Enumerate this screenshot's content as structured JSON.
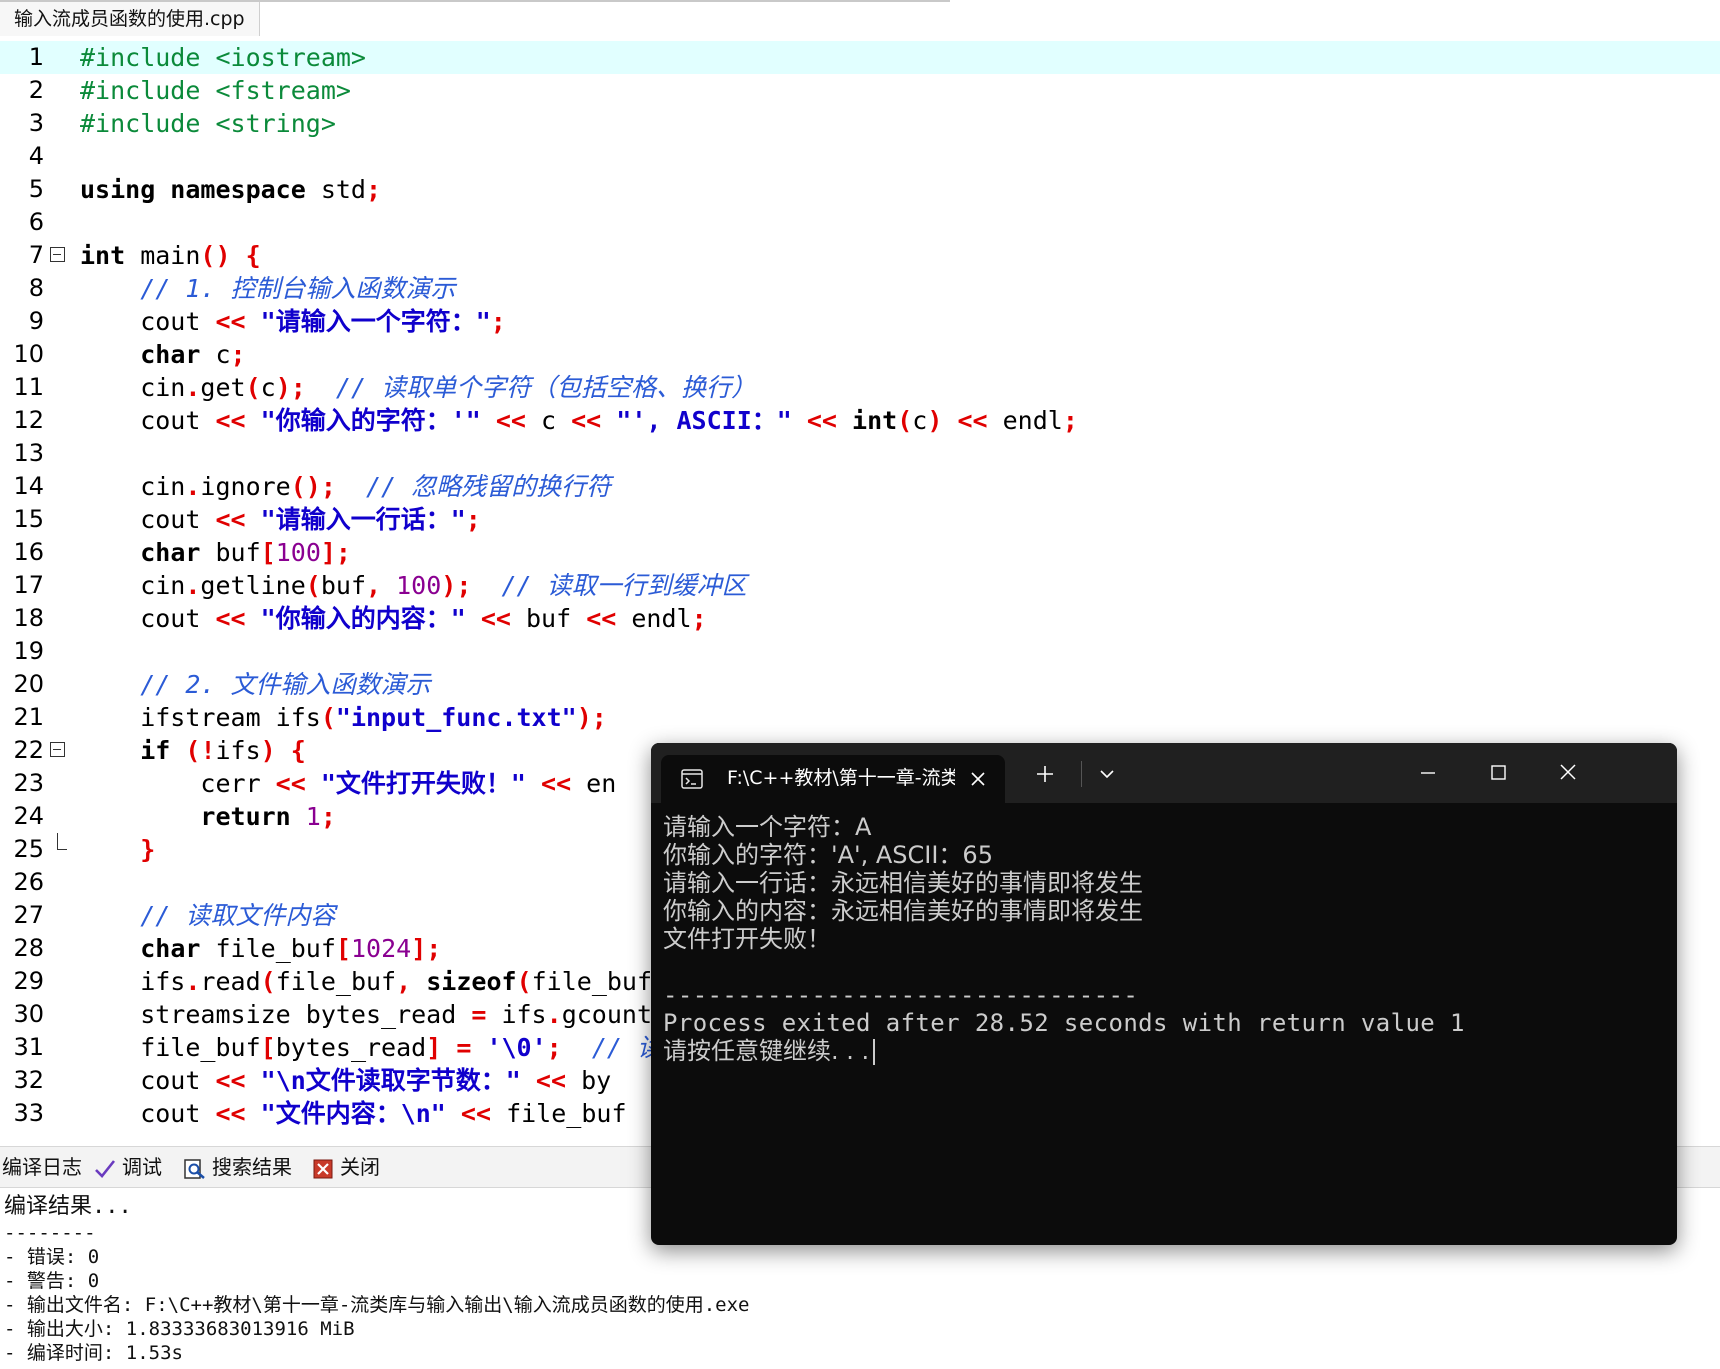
{
  "editor": {
    "file_tab": "输入流成员函数的使用.cpp",
    "lines": [
      {
        "n": "1",
        "tokens": [
          {
            "c": "pp",
            "t": "#include <iostream>"
          }
        ]
      },
      {
        "n": "2",
        "tokens": [
          {
            "c": "pp",
            "t": "#include <fstream>"
          }
        ]
      },
      {
        "n": "3",
        "tokens": [
          {
            "c": "pp",
            "t": "#include <string>"
          }
        ]
      },
      {
        "n": "4",
        "tokens": []
      },
      {
        "n": "5",
        "tokens": [
          {
            "c": "kw",
            "t": "using namespace"
          },
          {
            "c": "",
            "t": " std"
          },
          {
            "c": "sy",
            "t": ";"
          }
        ]
      },
      {
        "n": "6",
        "tokens": []
      },
      {
        "n": "7",
        "tokens": [
          {
            "c": "kw",
            "t": "int"
          },
          {
            "c": "",
            "t": " main"
          },
          {
            "c": "sy",
            "t": "() {"
          }
        ]
      },
      {
        "n": "8",
        "tokens": [
          {
            "c": "",
            "t": "    "
          },
          {
            "c": "cm",
            "t": "// 1. 控制台输入函数演示"
          }
        ]
      },
      {
        "n": "9",
        "tokens": [
          {
            "c": "",
            "t": "    cout "
          },
          {
            "c": "sy",
            "t": "<<"
          },
          {
            "c": "",
            "t": " "
          },
          {
            "c": "st",
            "t": "\"请输入一个字符：\""
          },
          {
            "c": "sy",
            "t": ";"
          }
        ]
      },
      {
        "n": "10",
        "tokens": [
          {
            "c": "",
            "t": "    "
          },
          {
            "c": "kw",
            "t": "char"
          },
          {
            "c": "",
            "t": " c"
          },
          {
            "c": "sy",
            "t": ";"
          }
        ]
      },
      {
        "n": "11",
        "tokens": [
          {
            "c": "",
            "t": "    cin"
          },
          {
            "c": "sy",
            "t": "."
          },
          {
            "c": "",
            "t": "get"
          },
          {
            "c": "sy",
            "t": "("
          },
          {
            "c": "",
            "t": "c"
          },
          {
            "c": "sy",
            "t": ");"
          },
          {
            "c": "",
            "t": "  "
          },
          {
            "c": "cm",
            "t": "// 读取单个字符（包括空格、换行）"
          }
        ]
      },
      {
        "n": "12",
        "tokens": [
          {
            "c": "",
            "t": "    cout "
          },
          {
            "c": "sy",
            "t": "<<"
          },
          {
            "c": "",
            "t": " "
          },
          {
            "c": "st",
            "t": "\"你输入的字符：'\""
          },
          {
            "c": "",
            "t": " "
          },
          {
            "c": "sy",
            "t": "<<"
          },
          {
            "c": "",
            "t": " c "
          },
          {
            "c": "sy",
            "t": "<<"
          },
          {
            "c": "",
            "t": " "
          },
          {
            "c": "st",
            "t": "\"', ASCII：\""
          },
          {
            "c": "",
            "t": " "
          },
          {
            "c": "sy",
            "t": "<<"
          },
          {
            "c": "",
            "t": " "
          },
          {
            "c": "kw",
            "t": "int"
          },
          {
            "c": "sy",
            "t": "("
          },
          {
            "c": "",
            "t": "c"
          },
          {
            "c": "sy",
            "t": ")"
          },
          {
            "c": "",
            "t": " "
          },
          {
            "c": "sy",
            "t": "<<"
          },
          {
            "c": "",
            "t": " endl"
          },
          {
            "c": "sy",
            "t": ";"
          }
        ]
      },
      {
        "n": "13",
        "tokens": []
      },
      {
        "n": "14",
        "tokens": [
          {
            "c": "",
            "t": "    cin"
          },
          {
            "c": "sy",
            "t": "."
          },
          {
            "c": "",
            "t": "ignore"
          },
          {
            "c": "sy",
            "t": "();"
          },
          {
            "c": "",
            "t": "  "
          },
          {
            "c": "cm",
            "t": "// 忽略残留的换行符"
          }
        ]
      },
      {
        "n": "15",
        "tokens": [
          {
            "c": "",
            "t": "    cout "
          },
          {
            "c": "sy",
            "t": "<<"
          },
          {
            "c": "",
            "t": " "
          },
          {
            "c": "st",
            "t": "\"请输入一行话：\""
          },
          {
            "c": "sy",
            "t": ";"
          }
        ]
      },
      {
        "n": "16",
        "tokens": [
          {
            "c": "",
            "t": "    "
          },
          {
            "c": "kw",
            "t": "char"
          },
          {
            "c": "",
            "t": " buf"
          },
          {
            "c": "sy",
            "t": "["
          },
          {
            "c": "nm",
            "t": "100"
          },
          {
            "c": "sy",
            "t": "];"
          }
        ]
      },
      {
        "n": "17",
        "tokens": [
          {
            "c": "",
            "t": "    cin"
          },
          {
            "c": "sy",
            "t": "."
          },
          {
            "c": "",
            "t": "getline"
          },
          {
            "c": "sy",
            "t": "("
          },
          {
            "c": "",
            "t": "buf"
          },
          {
            "c": "sy",
            "t": ","
          },
          {
            "c": "",
            "t": " "
          },
          {
            "c": "nm",
            "t": "100"
          },
          {
            "c": "sy",
            "t": ");"
          },
          {
            "c": "",
            "t": "  "
          },
          {
            "c": "cm",
            "t": "// 读取一行到缓冲区"
          }
        ]
      },
      {
        "n": "18",
        "tokens": [
          {
            "c": "",
            "t": "    cout "
          },
          {
            "c": "sy",
            "t": "<<"
          },
          {
            "c": "",
            "t": " "
          },
          {
            "c": "st",
            "t": "\"你输入的内容：\""
          },
          {
            "c": "",
            "t": " "
          },
          {
            "c": "sy",
            "t": "<<"
          },
          {
            "c": "",
            "t": " buf "
          },
          {
            "c": "sy",
            "t": "<<"
          },
          {
            "c": "",
            "t": " endl"
          },
          {
            "c": "sy",
            "t": ";"
          }
        ]
      },
      {
        "n": "19",
        "tokens": []
      },
      {
        "n": "20",
        "tokens": [
          {
            "c": "",
            "t": "    "
          },
          {
            "c": "cm",
            "t": "// 2. 文件输入函数演示"
          }
        ]
      },
      {
        "n": "21",
        "tokens": [
          {
            "c": "",
            "t": "    ifstream ifs"
          },
          {
            "c": "sy",
            "t": "("
          },
          {
            "c": "st",
            "t": "\"input_func.txt\""
          },
          {
            "c": "sy",
            "t": ");"
          }
        ]
      },
      {
        "n": "22",
        "tokens": [
          {
            "c": "",
            "t": "    "
          },
          {
            "c": "kw",
            "t": "if"
          },
          {
            "c": "",
            "t": " "
          },
          {
            "c": "sy",
            "t": "(!"
          },
          {
            "c": "",
            "t": "ifs"
          },
          {
            "c": "sy",
            "t": ") {"
          }
        ]
      },
      {
        "n": "23",
        "tokens": [
          {
            "c": "",
            "t": "        cerr "
          },
          {
            "c": "sy",
            "t": "<<"
          },
          {
            "c": "",
            "t": " "
          },
          {
            "c": "st",
            "t": "\"文件打开失败！\""
          },
          {
            "c": "",
            "t": " "
          },
          {
            "c": "sy",
            "t": "<<"
          },
          {
            "c": "",
            "t": " en"
          }
        ]
      },
      {
        "n": "24",
        "tokens": [
          {
            "c": "",
            "t": "        "
          },
          {
            "c": "kw",
            "t": "return"
          },
          {
            "c": "",
            "t": " "
          },
          {
            "c": "nm",
            "t": "1"
          },
          {
            "c": "sy",
            "t": ";"
          }
        ]
      },
      {
        "n": "25",
        "tokens": [
          {
            "c": "",
            "t": "    "
          },
          {
            "c": "sy",
            "t": "}"
          }
        ]
      },
      {
        "n": "26",
        "tokens": []
      },
      {
        "n": "27",
        "tokens": [
          {
            "c": "",
            "t": "    "
          },
          {
            "c": "cm",
            "t": "// 读取文件内容"
          }
        ]
      },
      {
        "n": "28",
        "tokens": [
          {
            "c": "",
            "t": "    "
          },
          {
            "c": "kw",
            "t": "char"
          },
          {
            "c": "",
            "t": " file_buf"
          },
          {
            "c": "sy",
            "t": "["
          },
          {
            "c": "nm",
            "t": "1024"
          },
          {
            "c": "sy",
            "t": "];"
          }
        ]
      },
      {
        "n": "29",
        "tokens": [
          {
            "c": "",
            "t": "    ifs"
          },
          {
            "c": "sy",
            "t": "."
          },
          {
            "c": "",
            "t": "read"
          },
          {
            "c": "sy",
            "t": "("
          },
          {
            "c": "",
            "t": "file_buf"
          },
          {
            "c": "sy",
            "t": ","
          },
          {
            "c": "",
            "t": " "
          },
          {
            "c": "kw",
            "t": "sizeof"
          },
          {
            "c": "sy",
            "t": "("
          },
          {
            "c": "",
            "t": "file_buf"
          }
        ]
      },
      {
        "n": "30",
        "tokens": [
          {
            "c": "",
            "t": "    streamsize bytes_read "
          },
          {
            "c": "sy",
            "t": "="
          },
          {
            "c": "",
            "t": " ifs"
          },
          {
            "c": "sy",
            "t": "."
          },
          {
            "c": "",
            "t": "gcount"
          }
        ]
      },
      {
        "n": "31",
        "tokens": [
          {
            "c": "",
            "t": "    file_buf"
          },
          {
            "c": "sy",
            "t": "["
          },
          {
            "c": "",
            "t": "bytes_read"
          },
          {
            "c": "sy",
            "t": "]"
          },
          {
            "c": "",
            "t": " "
          },
          {
            "c": "sy",
            "t": "="
          },
          {
            "c": "",
            "t": " "
          },
          {
            "c": "st",
            "t": "'\\0'"
          },
          {
            "c": "sy",
            "t": ";"
          },
          {
            "c": "",
            "t": "  "
          },
          {
            "c": "cm",
            "t": "// 读"
          }
        ]
      },
      {
        "n": "32",
        "tokens": [
          {
            "c": "",
            "t": "    cout "
          },
          {
            "c": "sy",
            "t": "<<"
          },
          {
            "c": "",
            "t": " "
          },
          {
            "c": "st",
            "t": "\"\\n文件读取字节数：\""
          },
          {
            "c": "",
            "t": " "
          },
          {
            "c": "sy",
            "t": "<<"
          },
          {
            "c": "",
            "t": " by"
          }
        ]
      },
      {
        "n": "33",
        "tokens": [
          {
            "c": "",
            "t": "    cout "
          },
          {
            "c": "sy",
            "t": "<<"
          },
          {
            "c": "",
            "t": " "
          },
          {
            "c": "st",
            "t": "\"文件内容：\\n\""
          },
          {
            "c": "",
            "t": " "
          },
          {
            "c": "sy",
            "t": "<<"
          },
          {
            "c": "",
            "t": " file_buf"
          }
        ]
      }
    ]
  },
  "bottom_tabs": [
    "编译日志",
    "调试",
    "搜索结果",
    "关闭"
  ],
  "compile_log": [
    "编译结果...",
    "--------",
    "- 错误: 0",
    "- 警告: 0",
    "- 输出文件名: F:\\C++教材\\第十一章-流类库与输入输出\\输入流成员函数的使用.exe",
    "- 输出大小: 1.83333683013916 MiB",
    "- 编译时间: 1.53s"
  ],
  "terminal": {
    "tab_title": "F:\\C++教材\\第十一章-流类库与",
    "lines": [
      "请输入一个字符：A",
      "你输入的字符：'A', ASCII：65",
      "请输入一行话：永远相信美好的事情即将发生",
      "你输入的内容：永远相信美好的事情即将发生",
      "文件打开失败！",
      "",
      "--------------------------------",
      "Process exited after 28.52 seconds with return value 1",
      "请按任意键继续. . ."
    ]
  },
  "icons": {
    "terminal_tab": "terminal-icon",
    "close": "close-icon",
    "new_tab": "plus-icon",
    "dropdown": "chevron-down-icon",
    "minimize": "minimize-icon",
    "maximize": "maximize-icon",
    "window_close": "window-close-icon",
    "debug": "checkmark-icon",
    "search_results": "search-icon",
    "close_tab": "close-panel-icon"
  }
}
